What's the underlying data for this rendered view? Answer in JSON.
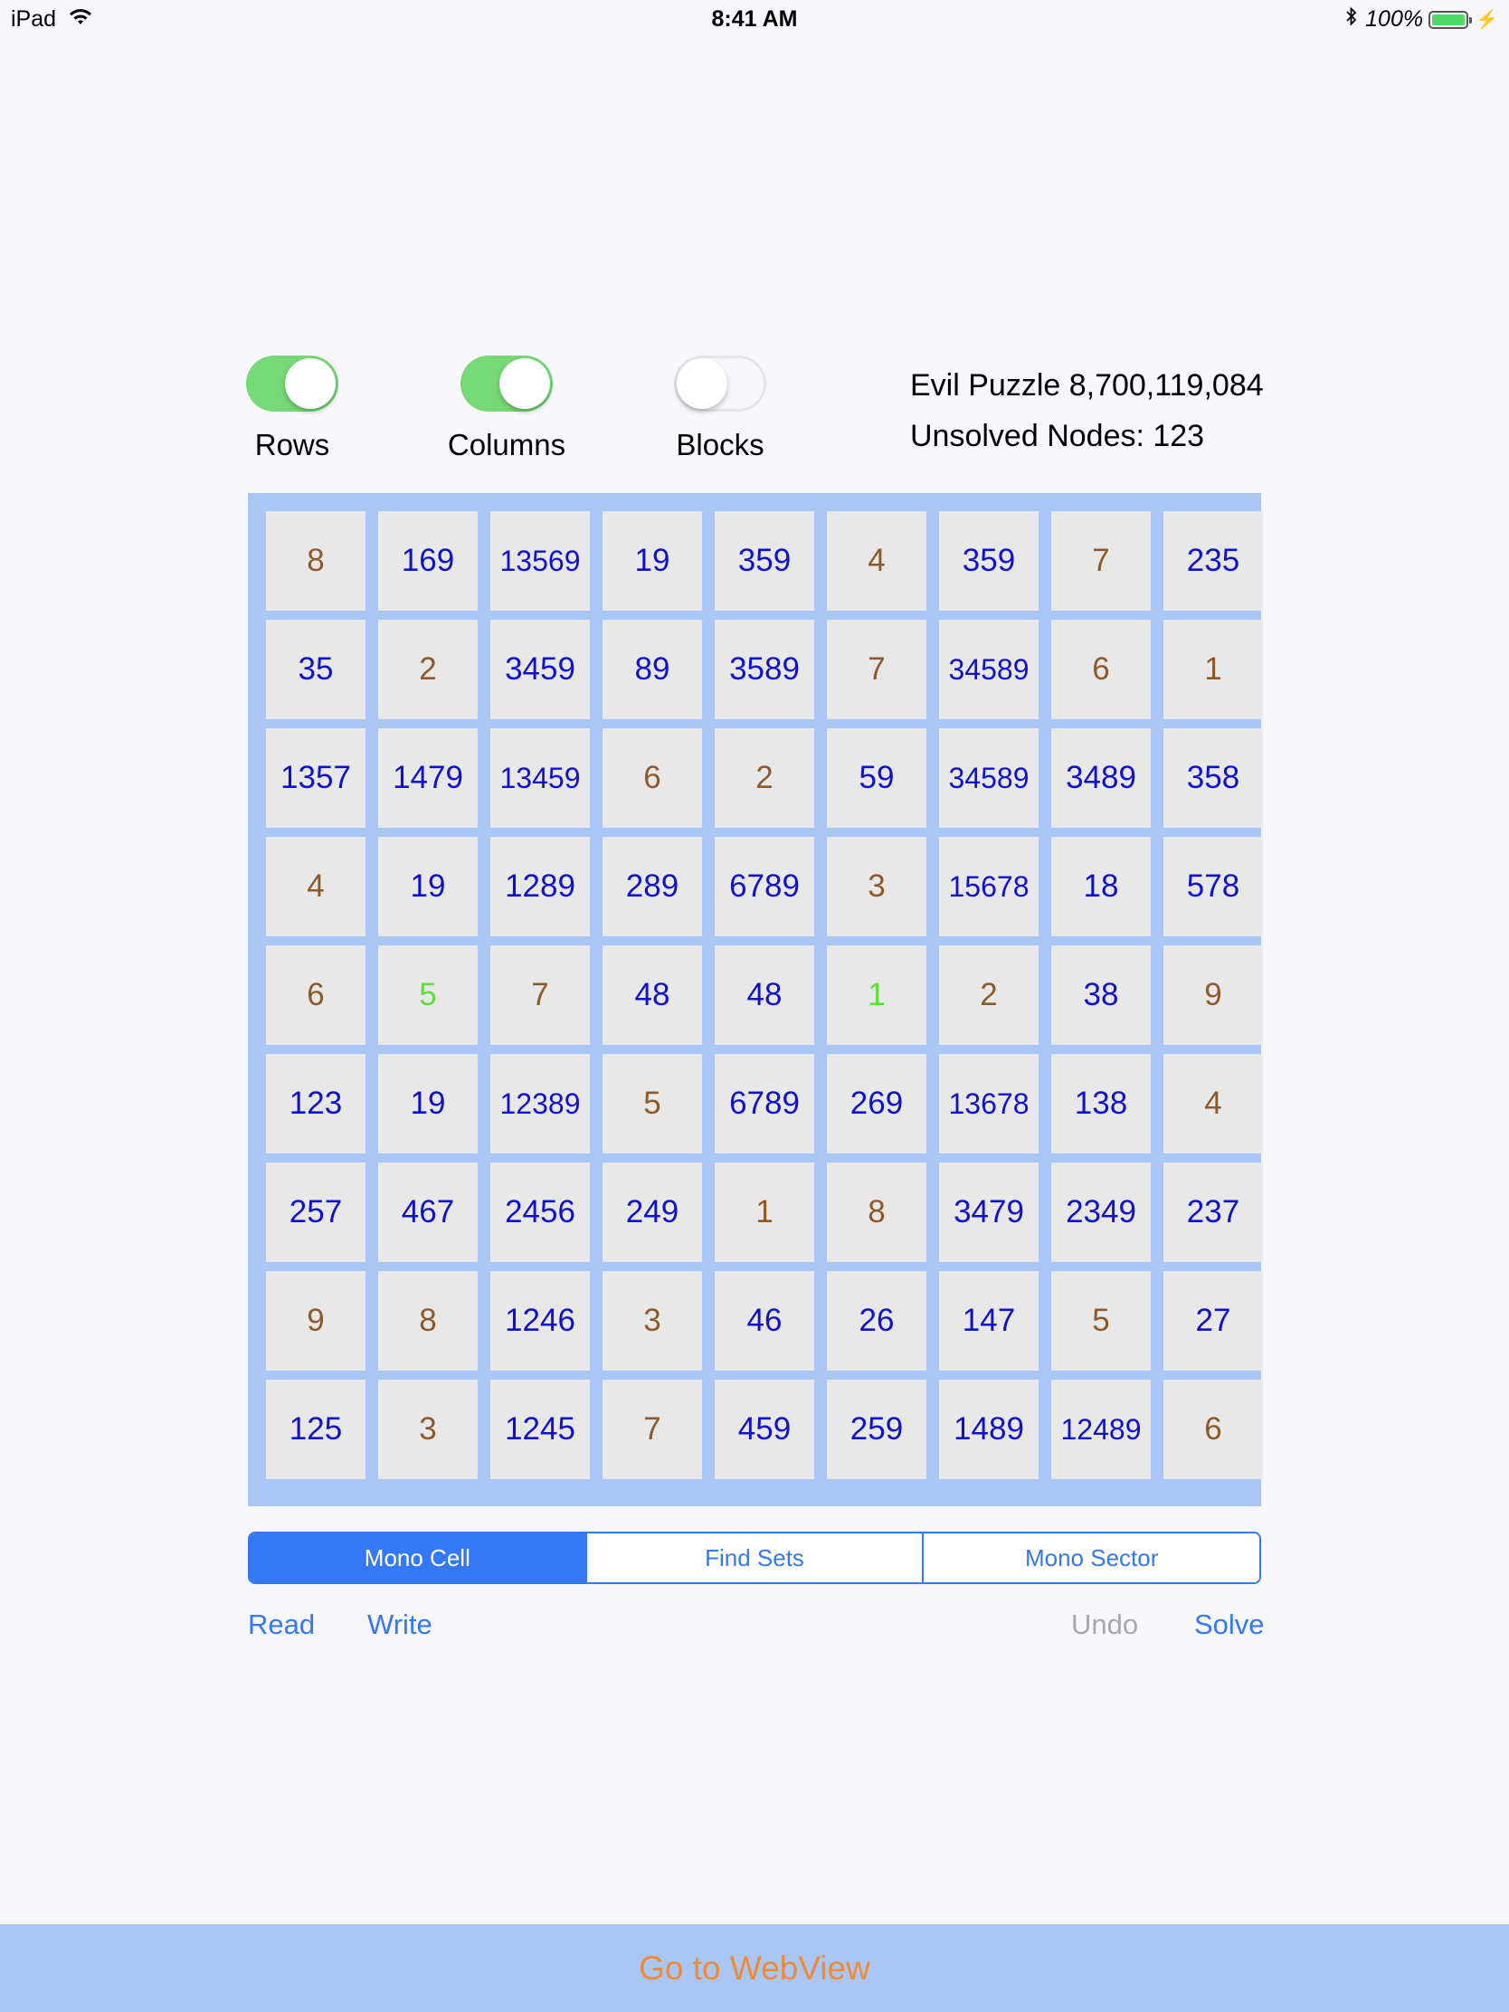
{
  "status_bar": {
    "device": "iPad",
    "time": "8:41 AM",
    "battery": "100%",
    "wifi_icon": "wifi-icon",
    "bluetooth_icon": "bluetooth-icon"
  },
  "toggles": [
    {
      "label": "Rows",
      "on": true
    },
    {
      "label": "Columns",
      "on": true
    },
    {
      "label": "Blocks",
      "on": false
    }
  ],
  "info": {
    "puzzle": "Evil Puzzle 8,700,119,084",
    "unsolved": "Unsolved Nodes: 123"
  },
  "colors": {
    "given": "#8c5a2b",
    "candidates": "#1010d0",
    "solved": "#5ede3b",
    "board_background": "#a9c6f5",
    "accent": "#3478f6",
    "footer_text": "#f08a36"
  },
  "grid": [
    [
      {
        "v": "8",
        "t": "given"
      },
      {
        "v": "169",
        "t": "cand"
      },
      {
        "v": "13569",
        "t": "cand"
      },
      {
        "v": "19",
        "t": "cand"
      },
      {
        "v": "359",
        "t": "cand"
      },
      {
        "v": "4",
        "t": "given"
      },
      {
        "v": "359",
        "t": "cand"
      },
      {
        "v": "7",
        "t": "given"
      },
      {
        "v": "235",
        "t": "cand"
      }
    ],
    [
      {
        "v": "35",
        "t": "cand"
      },
      {
        "v": "2",
        "t": "given"
      },
      {
        "v": "3459",
        "t": "cand"
      },
      {
        "v": "89",
        "t": "cand"
      },
      {
        "v": "3589",
        "t": "cand"
      },
      {
        "v": "7",
        "t": "given"
      },
      {
        "v": "34589",
        "t": "cand"
      },
      {
        "v": "6",
        "t": "given"
      },
      {
        "v": "1",
        "t": "given"
      }
    ],
    [
      {
        "v": "1357",
        "t": "cand"
      },
      {
        "v": "1479",
        "t": "cand"
      },
      {
        "v": "13459",
        "t": "cand"
      },
      {
        "v": "6",
        "t": "given"
      },
      {
        "v": "2",
        "t": "given"
      },
      {
        "v": "59",
        "t": "cand"
      },
      {
        "v": "34589",
        "t": "cand"
      },
      {
        "v": "3489",
        "t": "cand"
      },
      {
        "v": "358",
        "t": "cand"
      }
    ],
    [
      {
        "v": "4",
        "t": "given"
      },
      {
        "v": "19",
        "t": "cand"
      },
      {
        "v": "1289",
        "t": "cand"
      },
      {
        "v": "289",
        "t": "cand"
      },
      {
        "v": "6789",
        "t": "cand"
      },
      {
        "v": "3",
        "t": "given"
      },
      {
        "v": "15678",
        "t": "cand"
      },
      {
        "v": "18",
        "t": "cand"
      },
      {
        "v": "578",
        "t": "cand"
      }
    ],
    [
      {
        "v": "6",
        "t": "given"
      },
      {
        "v": "5",
        "t": "solved"
      },
      {
        "v": "7",
        "t": "given"
      },
      {
        "v": "48",
        "t": "cand"
      },
      {
        "v": "48",
        "t": "cand"
      },
      {
        "v": "1",
        "t": "solved"
      },
      {
        "v": "2",
        "t": "given"
      },
      {
        "v": "38",
        "t": "cand"
      },
      {
        "v": "9",
        "t": "given"
      }
    ],
    [
      {
        "v": "123",
        "t": "cand"
      },
      {
        "v": "19",
        "t": "cand"
      },
      {
        "v": "12389",
        "t": "cand"
      },
      {
        "v": "5",
        "t": "given"
      },
      {
        "v": "6789",
        "t": "cand"
      },
      {
        "v": "269",
        "t": "cand"
      },
      {
        "v": "13678",
        "t": "cand"
      },
      {
        "v": "138",
        "t": "cand"
      },
      {
        "v": "4",
        "t": "given"
      }
    ],
    [
      {
        "v": "257",
        "t": "cand"
      },
      {
        "v": "467",
        "t": "cand"
      },
      {
        "v": "2456",
        "t": "cand"
      },
      {
        "v": "249",
        "t": "cand"
      },
      {
        "v": "1",
        "t": "given"
      },
      {
        "v": "8",
        "t": "given"
      },
      {
        "v": "3479",
        "t": "cand"
      },
      {
        "v": "2349",
        "t": "cand"
      },
      {
        "v": "237",
        "t": "cand"
      }
    ],
    [
      {
        "v": "9",
        "t": "given"
      },
      {
        "v": "8",
        "t": "given"
      },
      {
        "v": "1246",
        "t": "cand"
      },
      {
        "v": "3",
        "t": "given"
      },
      {
        "v": "46",
        "t": "cand"
      },
      {
        "v": "26",
        "t": "cand"
      },
      {
        "v": "147",
        "t": "cand"
      },
      {
        "v": "5",
        "t": "given"
      },
      {
        "v": "27",
        "t": "cand"
      }
    ],
    [
      {
        "v": "125",
        "t": "cand"
      },
      {
        "v": "3",
        "t": "given"
      },
      {
        "v": "1245",
        "t": "cand"
      },
      {
        "v": "7",
        "t": "given"
      },
      {
        "v": "459",
        "t": "cand"
      },
      {
        "v": "259",
        "t": "cand"
      },
      {
        "v": "1489",
        "t": "cand"
      },
      {
        "v": "12489",
        "t": "cand"
      },
      {
        "v": "6",
        "t": "given"
      }
    ]
  ],
  "segmented": {
    "options": [
      "Mono Cell",
      "Find Sets",
      "Mono Sector"
    ],
    "selected": "Mono Cell"
  },
  "actions": {
    "read": "Read",
    "write": "Write",
    "undo": "Undo",
    "solve": "Solve",
    "undo_enabled": false
  },
  "footer": {
    "label": "Go to WebView"
  }
}
